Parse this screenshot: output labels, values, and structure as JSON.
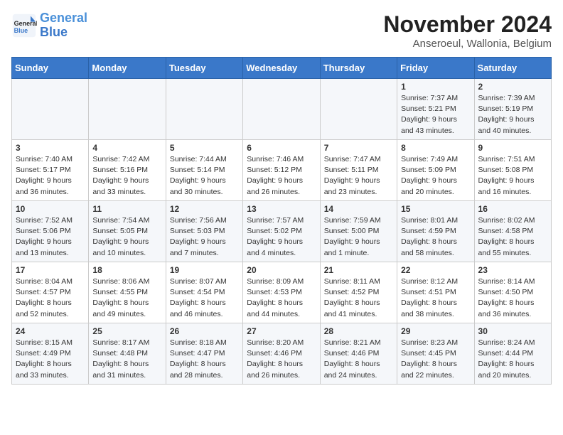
{
  "header": {
    "logo_line1": "General",
    "logo_line2": "Blue",
    "month": "November 2024",
    "location": "Anseroeul, Wallonia, Belgium"
  },
  "days_of_week": [
    "Sunday",
    "Monday",
    "Tuesday",
    "Wednesday",
    "Thursday",
    "Friday",
    "Saturday"
  ],
  "weeks": [
    [
      {
        "day": "",
        "info": ""
      },
      {
        "day": "",
        "info": ""
      },
      {
        "day": "",
        "info": ""
      },
      {
        "day": "",
        "info": ""
      },
      {
        "day": "",
        "info": ""
      },
      {
        "day": "1",
        "info": "Sunrise: 7:37 AM\nSunset: 5:21 PM\nDaylight: 9 hours and 43 minutes."
      },
      {
        "day": "2",
        "info": "Sunrise: 7:39 AM\nSunset: 5:19 PM\nDaylight: 9 hours and 40 minutes."
      }
    ],
    [
      {
        "day": "3",
        "info": "Sunrise: 7:40 AM\nSunset: 5:17 PM\nDaylight: 9 hours and 36 minutes."
      },
      {
        "day": "4",
        "info": "Sunrise: 7:42 AM\nSunset: 5:16 PM\nDaylight: 9 hours and 33 minutes."
      },
      {
        "day": "5",
        "info": "Sunrise: 7:44 AM\nSunset: 5:14 PM\nDaylight: 9 hours and 30 minutes."
      },
      {
        "day": "6",
        "info": "Sunrise: 7:46 AM\nSunset: 5:12 PM\nDaylight: 9 hours and 26 minutes."
      },
      {
        "day": "7",
        "info": "Sunrise: 7:47 AM\nSunset: 5:11 PM\nDaylight: 9 hours and 23 minutes."
      },
      {
        "day": "8",
        "info": "Sunrise: 7:49 AM\nSunset: 5:09 PM\nDaylight: 9 hours and 20 minutes."
      },
      {
        "day": "9",
        "info": "Sunrise: 7:51 AM\nSunset: 5:08 PM\nDaylight: 9 hours and 16 minutes."
      }
    ],
    [
      {
        "day": "10",
        "info": "Sunrise: 7:52 AM\nSunset: 5:06 PM\nDaylight: 9 hours and 13 minutes."
      },
      {
        "day": "11",
        "info": "Sunrise: 7:54 AM\nSunset: 5:05 PM\nDaylight: 9 hours and 10 minutes."
      },
      {
        "day": "12",
        "info": "Sunrise: 7:56 AM\nSunset: 5:03 PM\nDaylight: 9 hours and 7 minutes."
      },
      {
        "day": "13",
        "info": "Sunrise: 7:57 AM\nSunset: 5:02 PM\nDaylight: 9 hours and 4 minutes."
      },
      {
        "day": "14",
        "info": "Sunrise: 7:59 AM\nSunset: 5:00 PM\nDaylight: 9 hours and 1 minute."
      },
      {
        "day": "15",
        "info": "Sunrise: 8:01 AM\nSunset: 4:59 PM\nDaylight: 8 hours and 58 minutes."
      },
      {
        "day": "16",
        "info": "Sunrise: 8:02 AM\nSunset: 4:58 PM\nDaylight: 8 hours and 55 minutes."
      }
    ],
    [
      {
        "day": "17",
        "info": "Sunrise: 8:04 AM\nSunset: 4:57 PM\nDaylight: 8 hours and 52 minutes."
      },
      {
        "day": "18",
        "info": "Sunrise: 8:06 AM\nSunset: 4:55 PM\nDaylight: 8 hours and 49 minutes."
      },
      {
        "day": "19",
        "info": "Sunrise: 8:07 AM\nSunset: 4:54 PM\nDaylight: 8 hours and 46 minutes."
      },
      {
        "day": "20",
        "info": "Sunrise: 8:09 AM\nSunset: 4:53 PM\nDaylight: 8 hours and 44 minutes."
      },
      {
        "day": "21",
        "info": "Sunrise: 8:11 AM\nSunset: 4:52 PM\nDaylight: 8 hours and 41 minutes."
      },
      {
        "day": "22",
        "info": "Sunrise: 8:12 AM\nSunset: 4:51 PM\nDaylight: 8 hours and 38 minutes."
      },
      {
        "day": "23",
        "info": "Sunrise: 8:14 AM\nSunset: 4:50 PM\nDaylight: 8 hours and 36 minutes."
      }
    ],
    [
      {
        "day": "24",
        "info": "Sunrise: 8:15 AM\nSunset: 4:49 PM\nDaylight: 8 hours and 33 minutes."
      },
      {
        "day": "25",
        "info": "Sunrise: 8:17 AM\nSunset: 4:48 PM\nDaylight: 8 hours and 31 minutes."
      },
      {
        "day": "26",
        "info": "Sunrise: 8:18 AM\nSunset: 4:47 PM\nDaylight: 8 hours and 28 minutes."
      },
      {
        "day": "27",
        "info": "Sunrise: 8:20 AM\nSunset: 4:46 PM\nDaylight: 8 hours and 26 minutes."
      },
      {
        "day": "28",
        "info": "Sunrise: 8:21 AM\nSunset: 4:46 PM\nDaylight: 8 hours and 24 minutes."
      },
      {
        "day": "29",
        "info": "Sunrise: 8:23 AM\nSunset: 4:45 PM\nDaylight: 8 hours and 22 minutes."
      },
      {
        "day": "30",
        "info": "Sunrise: 8:24 AM\nSunset: 4:44 PM\nDaylight: 8 hours and 20 minutes."
      }
    ]
  ]
}
